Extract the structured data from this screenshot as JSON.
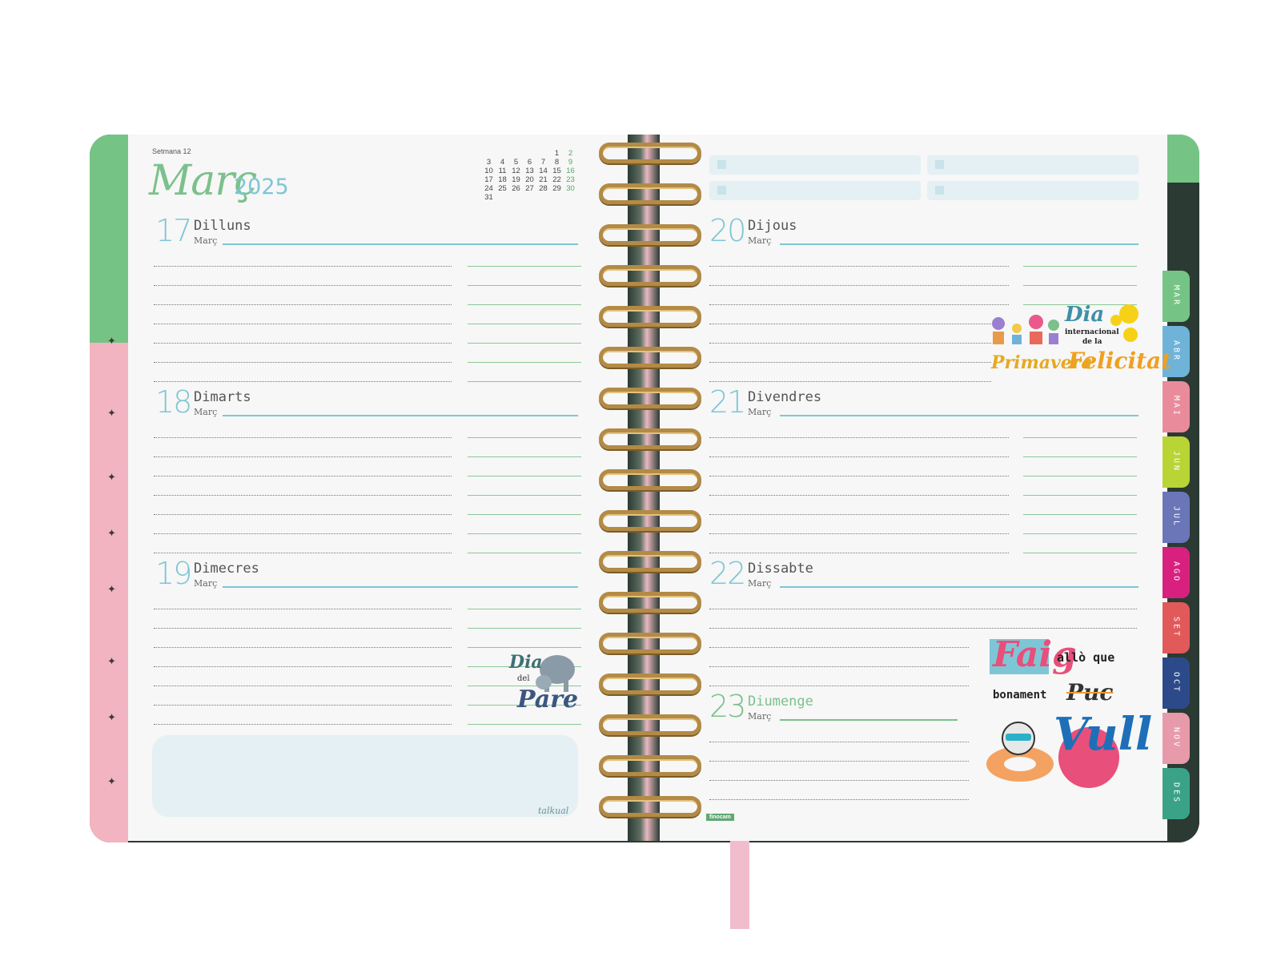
{
  "left_page": {
    "week_label": "Setmana 12",
    "month_title": "Març",
    "year": "2025",
    "mini_calendar": [
      [
        "",
        "",
        "",
        "",
        "",
        "1",
        "2"
      ],
      [
        "3",
        "4",
        "5",
        "6",
        "7",
        "8",
        "9"
      ],
      [
        "10",
        "11",
        "12",
        "13",
        "14",
        "15",
        "16"
      ],
      [
        "17",
        "18",
        "19",
        "20",
        "21",
        "22",
        "23"
      ],
      [
        "24",
        "25",
        "26",
        "27",
        "28",
        "29",
        "30"
      ],
      [
        "31",
        "",
        "",
        "",
        "",
        "",
        ""
      ]
    ],
    "days": [
      {
        "num": "17",
        "name": "Dilluns",
        "month": "Març"
      },
      {
        "num": "18",
        "name": "Dimarts",
        "month": "Març"
      },
      {
        "num": "19",
        "name": "Dimecres",
        "month": "Març"
      }
    ],
    "notes_brand": "talkual"
  },
  "right_page": {
    "days": [
      {
        "num": "20",
        "name": "Dijous",
        "month": "Març"
      },
      {
        "num": "21",
        "name": "Divendres",
        "month": "Març"
      },
      {
        "num": "22",
        "name": "Dissabte",
        "month": "Març"
      },
      {
        "num": "23",
        "name": "Diumenge",
        "month": "Març"
      }
    ],
    "brand": "finocam"
  },
  "month_tabs": [
    {
      "label": "MAR",
      "color": "#76c485"
    },
    {
      "label": "ABR",
      "color": "#6fb3d9"
    },
    {
      "label": "MAI",
      "color": "#e98b9b"
    },
    {
      "label": "JUN",
      "color": "#b8d435"
    },
    {
      "label": "JUL",
      "color": "#6b76b8"
    },
    {
      "label": "AGO",
      "color": "#d8207f"
    },
    {
      "label": "SET",
      "color": "#e2595a"
    },
    {
      "label": "OCT",
      "color": "#2c4a8a"
    },
    {
      "label": "NOV",
      "color": "#e79aaa"
    },
    {
      "label": "DES",
      "color": "#3aa287"
    }
  ],
  "stickers": {
    "dia_pare": {
      "line1": "Dia",
      "line2": "del",
      "line3": "Pare"
    },
    "dia_felicitat": {
      "line1": "Dia",
      "line2": "internacional",
      "line3": "de la",
      "line4": "Felicitat"
    },
    "primavera": {
      "text": "Primavera"
    },
    "faig": {
      "w1": "Faig",
      "w2": "allò que",
      "w3": "bonament",
      "w4": "Puc",
      "w5": "Vull"
    }
  }
}
